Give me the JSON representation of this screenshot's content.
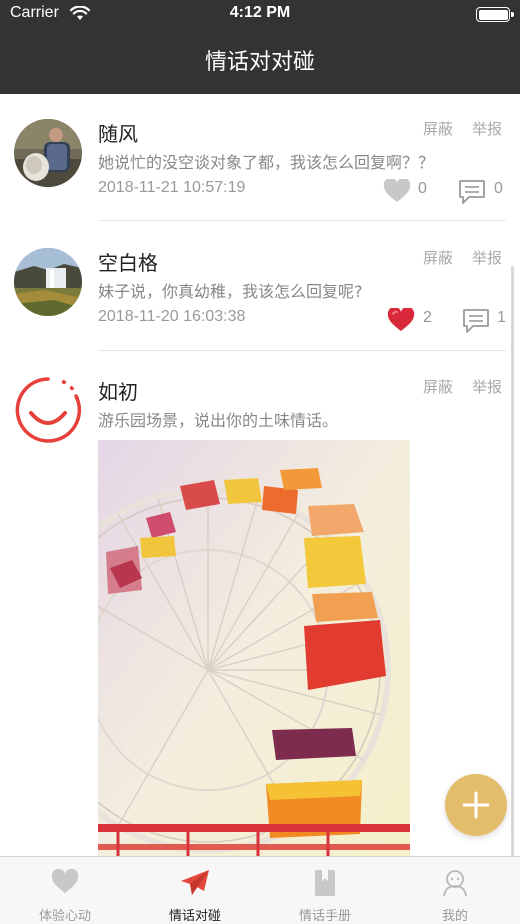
{
  "status_bar": {
    "carrier": "Carrier",
    "time": "4:12 PM"
  },
  "header": {
    "title": "情话对对碰"
  },
  "posts": [
    {
      "username": "随风",
      "block_label": "屏蔽",
      "report_label": "举报",
      "content": "她说忙的没空谈对象了都，我该怎么回复啊？？",
      "timestamp": "2018-11-21 10:57:19",
      "likes": "0",
      "comments": "0",
      "liked": false
    },
    {
      "username": "空白格",
      "block_label": "屏蔽",
      "report_label": "举报",
      "content": "妹子说，你真幼稚，我该怎么回复呢?",
      "timestamp": "2018-11-20 16:03:38",
      "likes": "2",
      "comments": "1",
      "liked": true
    },
    {
      "username": "如初",
      "block_label": "屏蔽",
      "report_label": "举报",
      "content": "游乐园场景，说出你的土味情话。"
    }
  ],
  "tabs": [
    {
      "label": "体验心动",
      "icon": "heart-icon",
      "active": false
    },
    {
      "label": "情话对碰",
      "icon": "paper-plane-icon",
      "active": true
    },
    {
      "label": "情话手册",
      "icon": "book-icon",
      "active": false
    },
    {
      "label": "我的",
      "icon": "profile-icon",
      "active": false
    }
  ],
  "colors": {
    "header": "#333333",
    "fab": "#e3bd6b",
    "like_active": "#d9283a",
    "tab_active": "#e4473b",
    "avatar_ring": "#e6403a"
  }
}
